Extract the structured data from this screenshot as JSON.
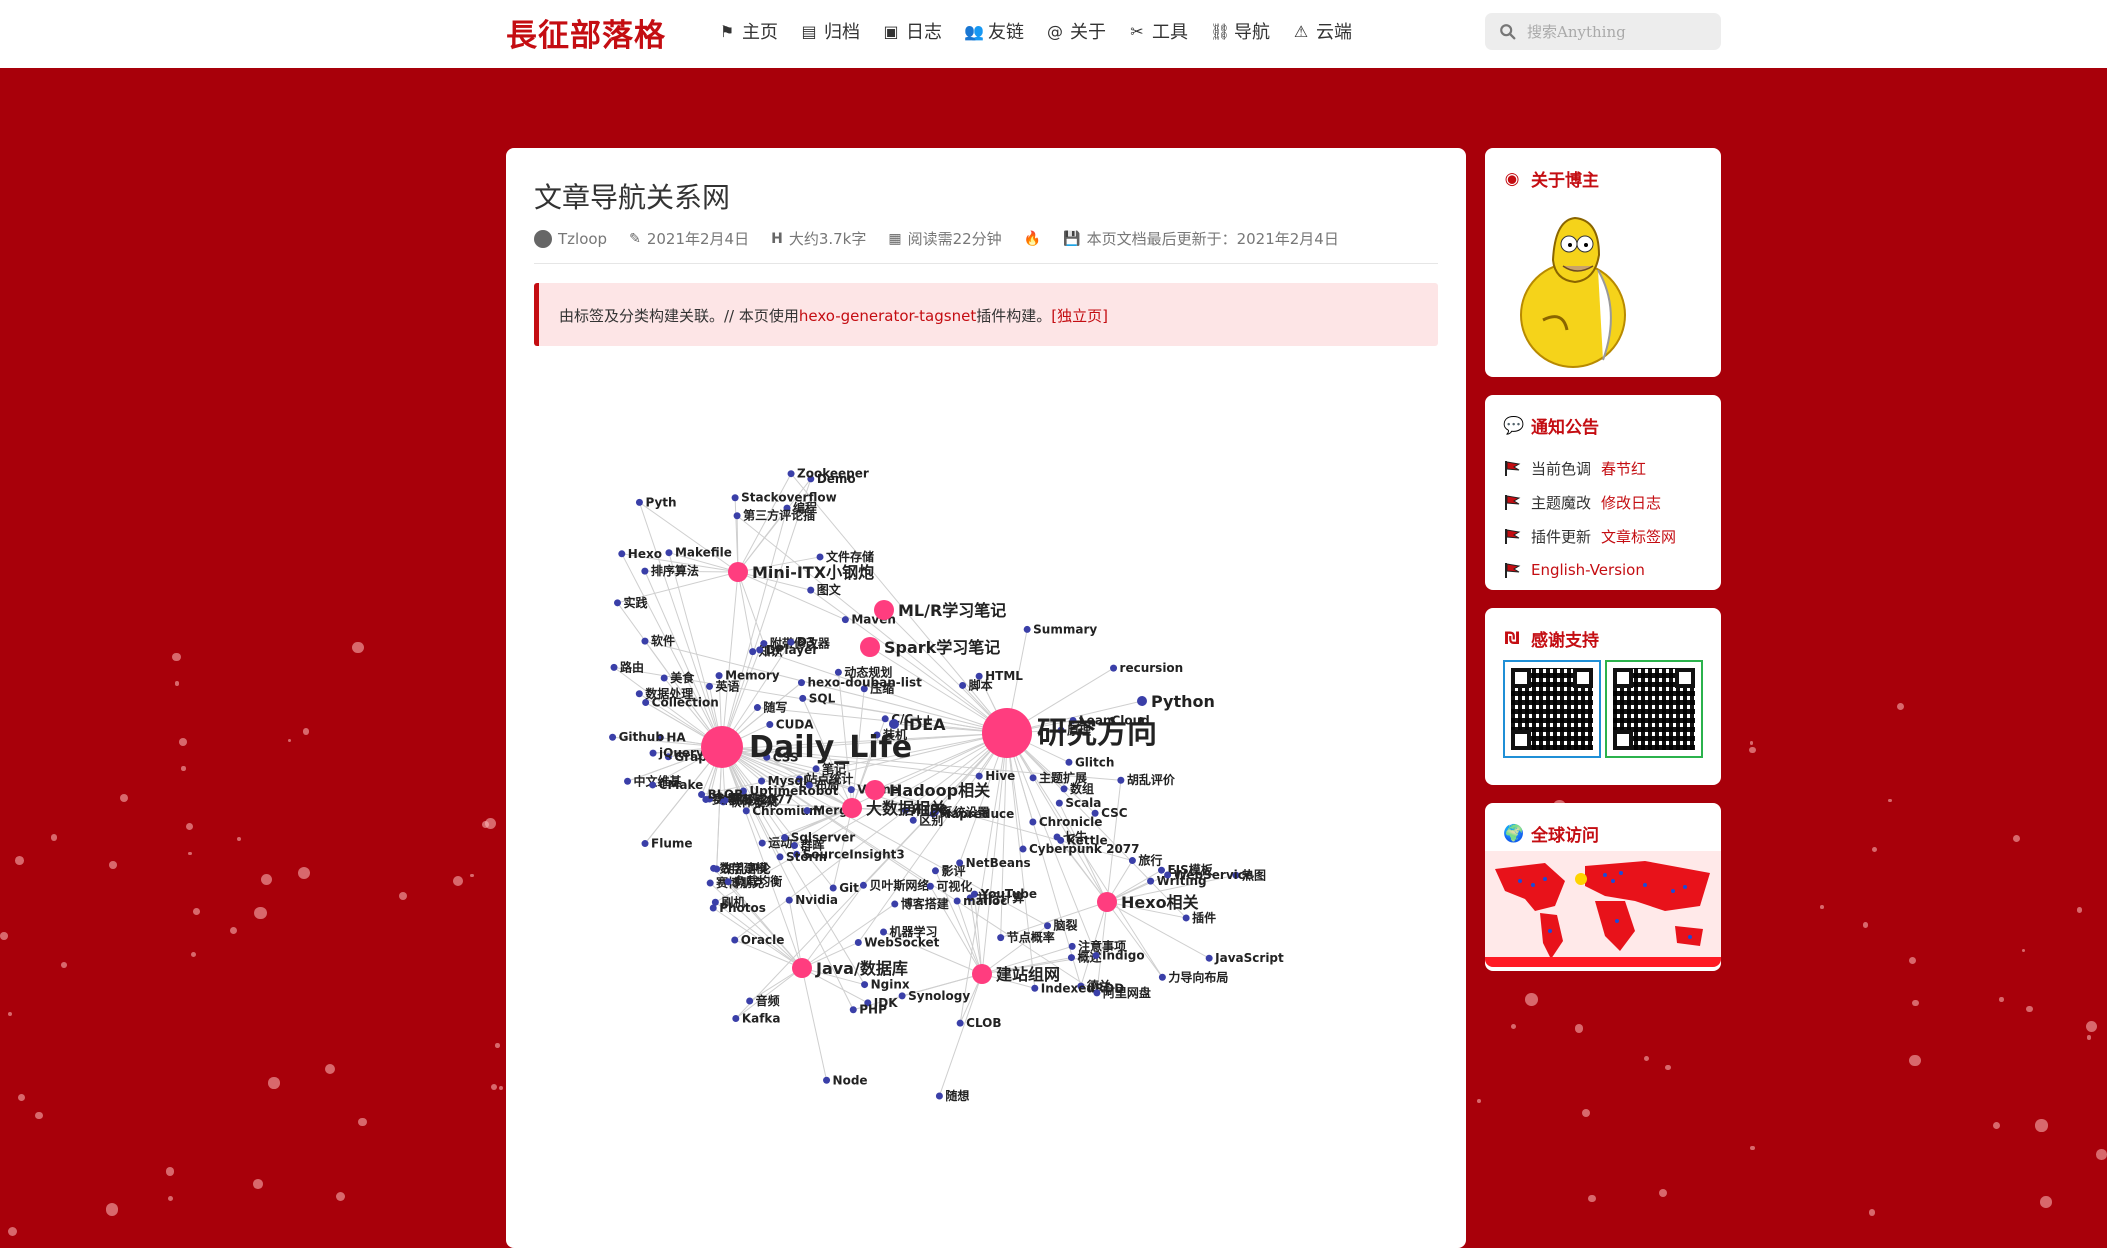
{
  "site": {
    "logo": "長征部落格"
  },
  "nav": {
    "items": [
      {
        "label": "主页",
        "icon": "flag-icon"
      },
      {
        "label": "归档",
        "icon": "archive-icon"
      },
      {
        "label": "日志",
        "icon": "book-icon"
      },
      {
        "label": "友链",
        "icon": "users-icon"
      },
      {
        "label": "关于",
        "icon": "at-icon"
      },
      {
        "label": "工具",
        "icon": "tools-icon"
      },
      {
        "label": "导航",
        "icon": "sitemap-icon"
      },
      {
        "label": "云端",
        "icon": "warning-icon"
      }
    ],
    "search_placeholder": "搜索Anything"
  },
  "post": {
    "title": "文章导航关系网",
    "author": "Tzloop",
    "date": "2021年2月4日",
    "word_count": "大约3.7k字",
    "read_time": "阅读需22分钟",
    "updated": "本页文档最后更新于：2021年2月4日",
    "notice_prefix": "由标签及分类构建关联。// 本页使用",
    "notice_link": "hexo-generator-tagsnet",
    "notice_middle": "插件构建。",
    "notice_standalone": "[独立页]"
  },
  "graph": {
    "hubs": [
      "Daily_Life",
      "研究方向"
    ],
    "majors": [
      "Mini-ITX小钢炮",
      "ML/R学习笔记",
      "Spark学习笔记",
      "Hadoop相关",
      "大数据相关",
      "Java/数据库",
      "建站组网",
      "Hexo相关",
      "Python",
      "IDEA"
    ],
    "minors": [
      "软件",
      "赛博朋克2077",
      "Cyberpunk 2077",
      "附带修改器",
      "装机",
      "赛博朋克",
      "注意事项",
      "德兰",
      "中文维基",
      "胡乱评论",
      "CSC",
      "图文",
      "运动",
      "Photos",
      "YouTube",
      "旅行",
      "站点统计",
      "随写",
      "Summary",
      "编程",
      "压缩",
      "刷机",
      "随想",
      "胡乱评价",
      "美食",
      "Memory",
      "Chronicle",
      "知识",
      "软件框架",
      "音频",
      "影评",
      "Writing",
      "英语",
      "Flume",
      "Hive",
      "实践",
      "布局",
      "JDK",
      "概述",
      "Scala",
      "GraphX",
      "Collection",
      "原理",
      "Demo",
      "笔记",
      "贝叶斯网络",
      "机器学习",
      "节点概率",
      "数据处理",
      "CUDA",
      "系统设置",
      "Makefile",
      "Git",
      "Nvidia",
      "IndexedRDD",
      "热图",
      "D3",
      "CMake",
      "NetBeans",
      "Maven",
      "Mapreduce",
      "数学建模",
      "并行计算",
      "力导向布局",
      "力导向",
      "SourceInsight3",
      "主题扩展",
      "Pyth",
      "SQL",
      "Kafka",
      "脑裂",
      "Kettle",
      "Storm",
      "HA",
      "区别",
      "Zookeeper",
      "C/C++",
      "Node",
      "malloc",
      "JavaScript",
      "jQuery",
      "Mysql",
      "HTML",
      "Hexo",
      "群晖",
      "WebSocket",
      "可视化",
      "EJS模板",
      "UptimeRobot",
      "评论系统",
      "LeanCloud",
      "第三方评论插",
      "CSS",
      "博客搭建",
      "Indigo",
      "插件",
      "Valine",
      "Chromium",
      "recursion",
      "Stackoverflow",
      "动态规划",
      "Oracle",
      "CLOB",
      "WebService",
      "BLOB",
      "Merge",
      "数组",
      "排序算法",
      "Sqlserver",
      "负载均衡",
      "PHP",
      "七牛",
      "DPlayer",
      "Github",
      "Glitch",
      "文件存储",
      "HTPC",
      "Nginx",
      "Synology",
      "阿里网盘",
      "hexo-douban-list",
      "路由",
      "脚本"
    ]
  },
  "sidebar": {
    "about": {
      "title": "关于博主"
    },
    "announcements": {
      "title": "通知公告",
      "items": [
        {
          "prefix": "当前色调",
          "link": "春节红"
        },
        {
          "prefix": "主题魔改",
          "link": "修改日志"
        },
        {
          "prefix": "插件更新",
          "link": "文章标签网"
        },
        {
          "prefix": "",
          "link": "English-Version"
        }
      ]
    },
    "support": {
      "title": "感谢支持"
    },
    "visits": {
      "title": "全球访问"
    }
  },
  "colors": {
    "accent": "#c40d12",
    "background": "#a8000a",
    "hub": "#ff3d7f",
    "leaf": "#3a3fa8"
  }
}
